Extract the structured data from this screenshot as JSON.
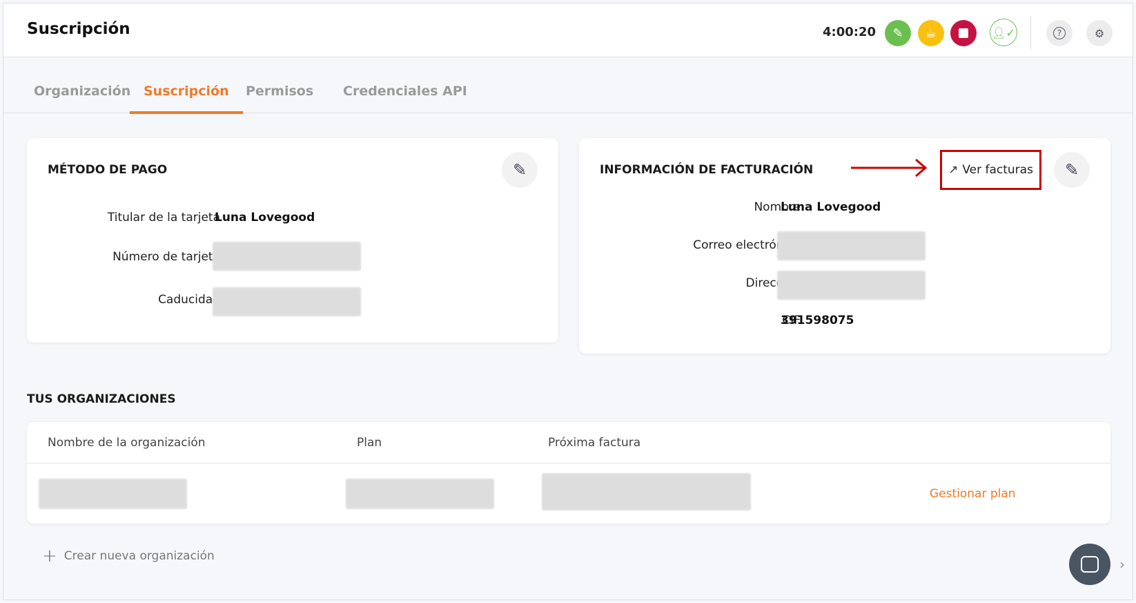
{
  "header": {
    "title": "Suscripción",
    "timer": "4:00:20"
  },
  "tabs": [
    {
      "label": "Organización"
    },
    {
      "label": "Suscripción"
    },
    {
      "label": "Permisos"
    },
    {
      "label": "Credenciales API"
    }
  ],
  "payment": {
    "title": "MÉTODO DE PAGO",
    "holder_label": "Titular de la tarjeta",
    "holder": "Luna Lovegood",
    "number_label": "Número de tarjeta",
    "expiry_label": "Caducidad"
  },
  "billing": {
    "title": "INFORMACIÓN DE FACTURACIÓN",
    "invoices_label": "Ver facturas",
    "name_label": "Nombre",
    "name": "Luna Lovegood",
    "email_label": "Correo electrónico",
    "address_label": "Dirección",
    "cif_label": "CIF",
    "cif": "391598075"
  },
  "orgs": {
    "title": "TUS ORGANIZACIONES",
    "columns": [
      "Nombre de la organización",
      "Plan",
      "Próxima factura"
    ],
    "manage_label": "Gestionar plan",
    "create_label": "Crear nueva organización"
  },
  "colors": {
    "accent": "#f07a26",
    "green": "#6bbf4e",
    "yellow": "#f9c00f",
    "red": "#c51244",
    "annotation": "#cc0000"
  }
}
